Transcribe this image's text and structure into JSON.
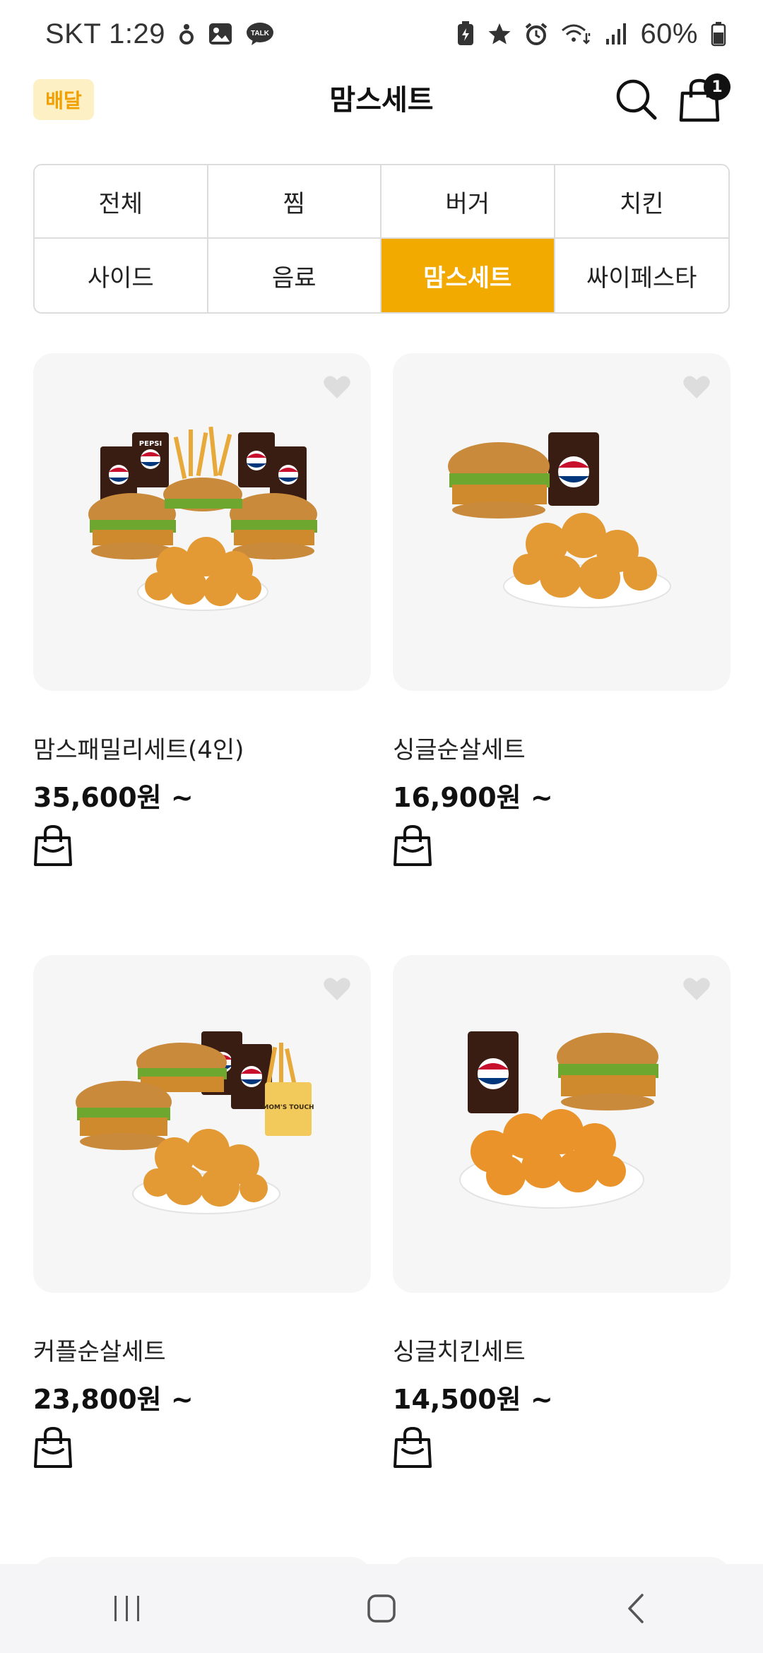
{
  "status_bar": {
    "carrier_time": "SKT 1:29",
    "battery": "60%",
    "icons": [
      "notification-dot-icon",
      "gallery-icon",
      "talk-icon",
      "battery-saver-icon",
      "star-icon",
      "alarm-icon",
      "wifi-icon",
      "signal-icon",
      "battery-icon"
    ],
    "talk_label": "TALK"
  },
  "header": {
    "delivery_badge": "배달",
    "title": "맘스세트",
    "cart_count": "1"
  },
  "categories": [
    {
      "label": "전체",
      "active": false
    },
    {
      "label": "찜",
      "active": false
    },
    {
      "label": "버거",
      "active": false
    },
    {
      "label": "치킨",
      "active": false
    },
    {
      "label": "사이드",
      "active": false
    },
    {
      "label": "음료",
      "active": false
    },
    {
      "label": "맘스세트",
      "active": true
    },
    {
      "label": "싸이페스타",
      "active": false
    }
  ],
  "products": [
    {
      "name": "맘스패밀리세트(4인)",
      "price": "35,600원 ~"
    },
    {
      "name": "싱글순살세트",
      "price": "16,900원 ~"
    },
    {
      "name": "커플순살세트",
      "price": "23,800원 ~"
    },
    {
      "name": "싱글치킨세트",
      "price": "14,500원 ~"
    }
  ],
  "image_text": {
    "pepsi": "PEPSI",
    "moms_touch": "MOM'S TOUCH"
  },
  "colors": {
    "accent": "#f2a900",
    "badge_bg": "#fdf0c4",
    "card_bg": "#f6f6f6"
  },
  "nav": {
    "icons": [
      "recent-apps-icon",
      "home-icon",
      "back-icon"
    ]
  }
}
